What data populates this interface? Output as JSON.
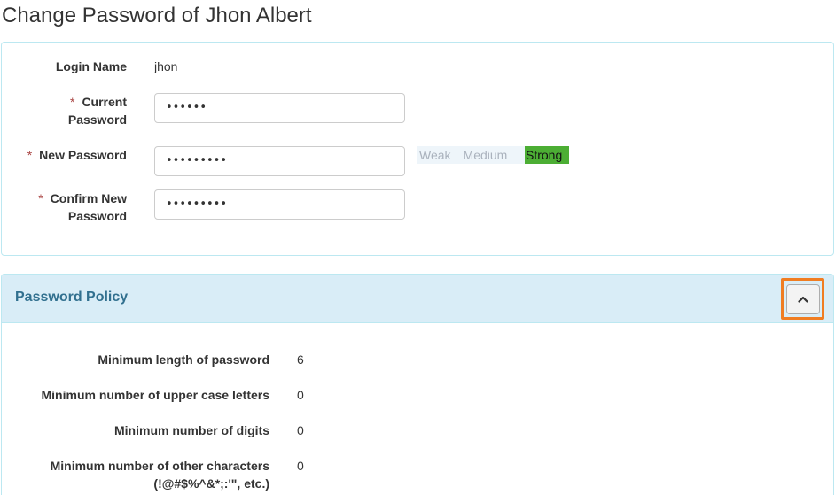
{
  "page": {
    "title": "Change Password of Jhon Albert"
  },
  "form": {
    "login_name_label": "Login Name",
    "login_name_value": "jhon",
    "required_mark": "*",
    "current_password_label_line1": "Current",
    "current_password_label_line2": "Password",
    "current_password_value": "••••••",
    "new_password_label": "New Password",
    "new_password_value": "•••••••••",
    "confirm_password_label_line1": "Confirm New",
    "confirm_password_label_line2": "Password",
    "confirm_password_value": "•••••••••"
  },
  "strength_meter": {
    "weak": "Weak",
    "medium": "Medium",
    "strong": "Strong",
    "active_level": "Strong",
    "active_color": "#4cae34"
  },
  "policy": {
    "heading": "Password Policy",
    "collapse_icon": "chevron-up-icon",
    "rows": [
      {
        "label": "Minimum length of password",
        "value": "6"
      },
      {
        "label": "Minimum number of upper case letters",
        "value": "0"
      },
      {
        "label": "Minimum number of digits",
        "value": "0"
      },
      {
        "label_line1": "Minimum number of other characters",
        "label_line2": "(!@#$%^&*;:'\", etc.)",
        "value": "0"
      }
    ]
  },
  "colors": {
    "panel_border": "#bce8f1",
    "heading_bg": "#d9edf7",
    "heading_text": "#31708f",
    "required": "#a94442",
    "highlight_outline": "#f07d22"
  }
}
